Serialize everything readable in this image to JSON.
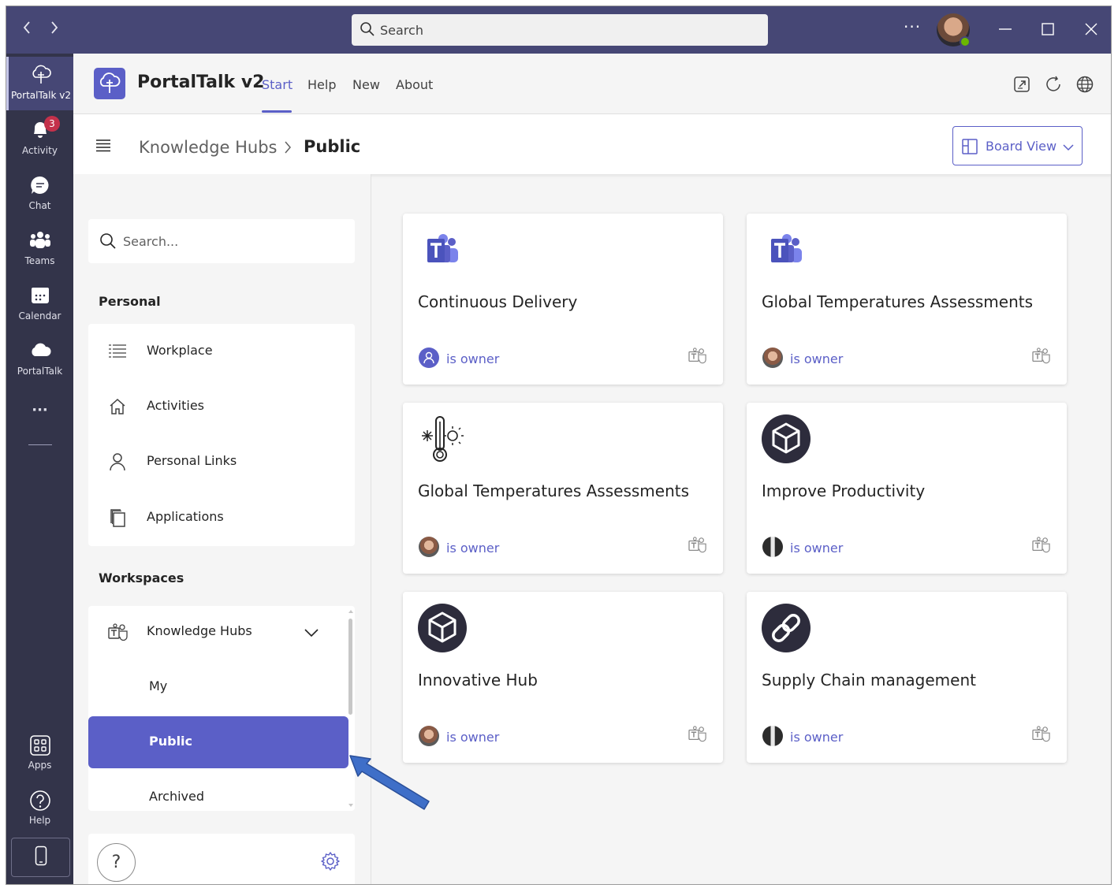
{
  "titlebar": {
    "search_placeholder": "Search",
    "more": "···"
  },
  "rail": {
    "items": [
      {
        "label": "PortalTalk v2",
        "icon": "portaltalk-icon"
      },
      {
        "label": "Activity",
        "icon": "bell-icon",
        "badge": "3"
      },
      {
        "label": "Chat",
        "icon": "chat-icon"
      },
      {
        "label": "Teams",
        "icon": "teams-icon"
      },
      {
        "label": "Calendar",
        "icon": "calendar-icon"
      },
      {
        "label": "PortalTalk",
        "icon": "cloud-icon"
      },
      {
        "label": "···",
        "icon": "more-icon"
      }
    ],
    "bottom": [
      {
        "label": "Apps",
        "icon": "apps-icon"
      },
      {
        "label": "Help",
        "icon": "help-icon"
      }
    ]
  },
  "app": {
    "title": "PortalTalk v2",
    "tabs": [
      "Start",
      "Help",
      "New",
      "About"
    ],
    "active_tab": "Start"
  },
  "breadcrumb": {
    "parent": "Knowledge Hubs",
    "current": "Public"
  },
  "view_toggle": {
    "label": "Board View"
  },
  "sidepanel": {
    "search_placeholder": "Search...",
    "personal_heading": "Personal",
    "personal_items": [
      "Workplace",
      "Activities",
      "Personal Links",
      "Applications"
    ],
    "workspaces_heading": "Workspaces",
    "workspace_group": "Knowledge Hubs",
    "workspace_items": [
      "My",
      "Public",
      "Archived"
    ],
    "selected": "Public",
    "help": "?"
  },
  "cards": [
    {
      "title": "Continuous Delivery",
      "owner": "is owner",
      "icon": "teams-logo-icon",
      "avatar": "generic"
    },
    {
      "title": "Global Temperatures Assessments",
      "owner": "is owner",
      "icon": "teams-logo-icon",
      "avatar": "person"
    },
    {
      "title": "Global Temperatures Assessments",
      "owner": "is owner",
      "icon": "thermometer-icon",
      "avatar": "person"
    },
    {
      "title": "Improve Productivity",
      "owner": "is owner",
      "icon": "cube-icon",
      "avatar": "dark"
    },
    {
      "title": "Innovative Hub",
      "owner": "is owner",
      "icon": "cube-icon",
      "avatar": "person"
    },
    {
      "title": "Supply Chain management",
      "owner": "is owner",
      "icon": "link-icon",
      "avatar": "dark"
    }
  ],
  "colors": {
    "titlebar": "#464775",
    "rail": "#33344a",
    "accent": "#5b5fc7",
    "annotation_arrow": "#3f6fc8"
  }
}
